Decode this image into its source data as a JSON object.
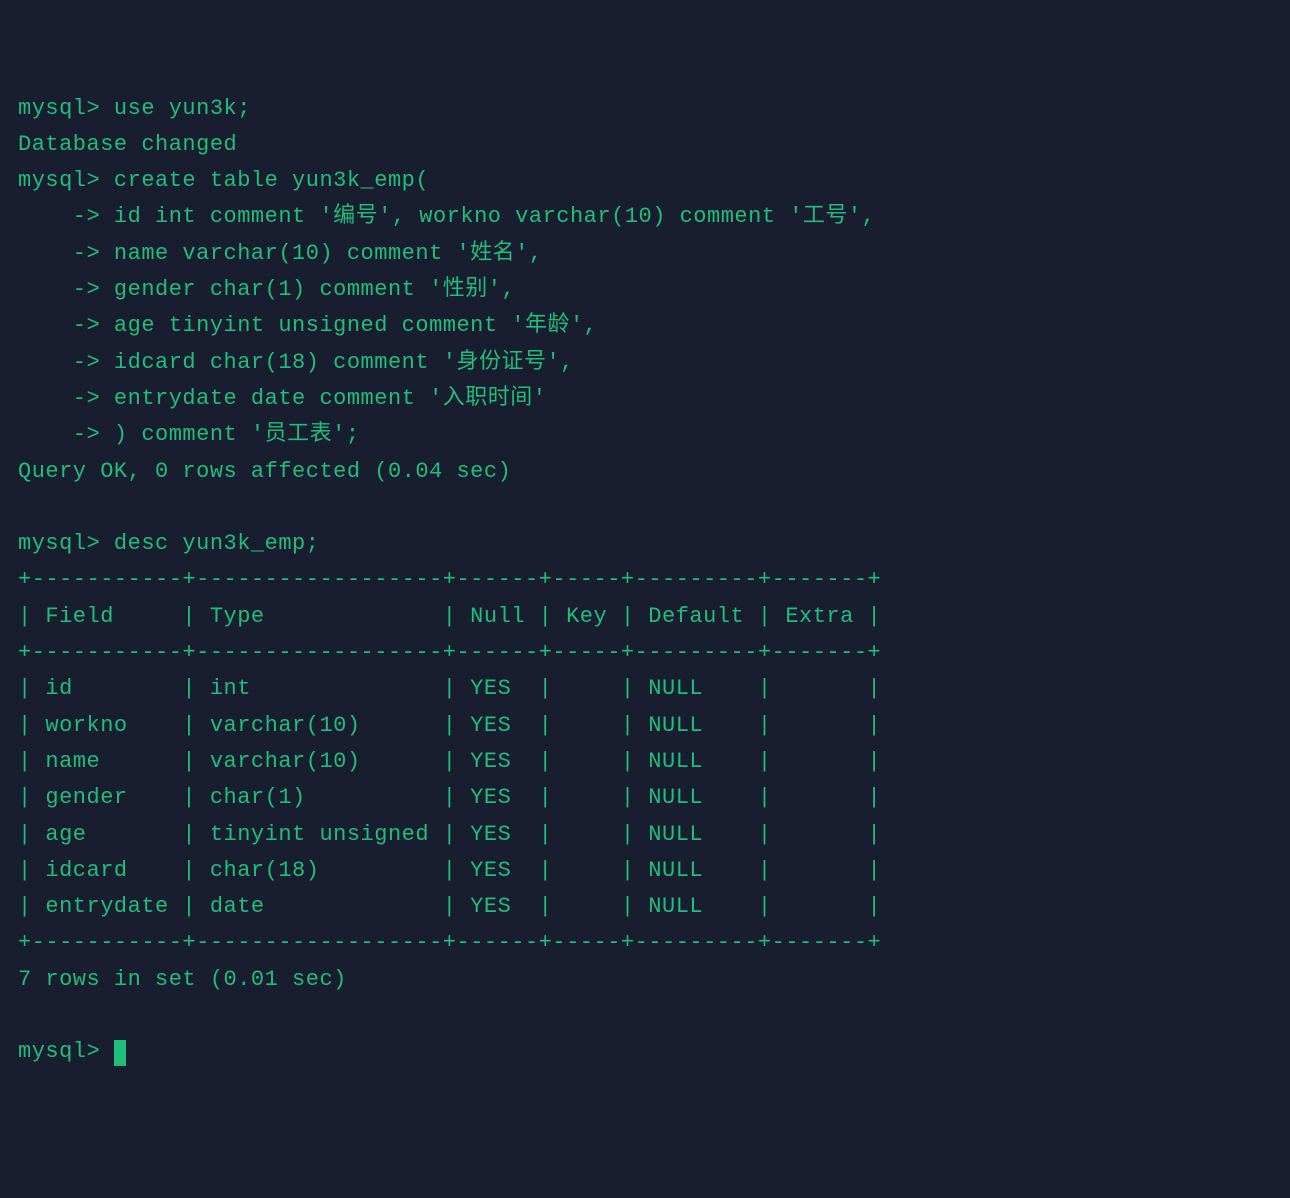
{
  "lines": {
    "l1": "mysql> use yun3k;",
    "l2": "Database changed",
    "l3": "mysql> create table yun3k_emp(",
    "l4": "    -> id int comment '编号', workno varchar(10) comment '工号',",
    "l5": "    -> name varchar(10) comment '姓名',",
    "l6": "    -> gender char(1) comment '性别',",
    "l7": "    -> age tinyint unsigned comment '年龄',",
    "l8": "    -> idcard char(18) comment '身份证号',",
    "l9": "    -> entrydate date comment '入职时间'",
    "l10": "    -> ) comment '员工表';",
    "l11": "Query OK, 0 rows affected (0.04 sec)",
    "l12": "",
    "l13": "mysql> desc yun3k_emp;",
    "l14": "+-----------+------------------+------+-----+---------+-------+",
    "l15": "| Field     | Type             | Null | Key | Default | Extra |",
    "l16": "+-----------+------------------+------+-----+---------+-------+",
    "l17": "| id        | int              | YES  |     | NULL    |       |",
    "l18": "| workno    | varchar(10)      | YES  |     | NULL    |       |",
    "l19": "| name      | varchar(10)      | YES  |     | NULL    |       |",
    "l20": "| gender    | char(1)          | YES  |     | NULL    |       |",
    "l21": "| age       | tinyint unsigned | YES  |     | NULL    |       |",
    "l22": "| idcard    | char(18)         | YES  |     | NULL    |       |",
    "l23": "| entrydate | date             | YES  |     | NULL    |       |",
    "l24": "+-----------+------------------+------+-----+---------+-------+",
    "l25": "7 rows in set (0.01 sec)",
    "l26": "",
    "l27": "mysql> "
  },
  "table": {
    "headers": [
      "Field",
      "Type",
      "Null",
      "Key",
      "Default",
      "Extra"
    ],
    "rows": [
      {
        "field": "id",
        "type": "int",
        "null": "YES",
        "key": "",
        "default": "NULL",
        "extra": ""
      },
      {
        "field": "workno",
        "type": "varchar(10)",
        "null": "YES",
        "key": "",
        "default": "NULL",
        "extra": ""
      },
      {
        "field": "name",
        "type": "varchar(10)",
        "null": "YES",
        "key": "",
        "default": "NULL",
        "extra": ""
      },
      {
        "field": "gender",
        "type": "char(1)",
        "null": "YES",
        "key": "",
        "default": "NULL",
        "extra": ""
      },
      {
        "field": "age",
        "type": "tinyint unsigned",
        "null": "YES",
        "key": "",
        "default": "NULL",
        "extra": ""
      },
      {
        "field": "idcard",
        "type": "char(18)",
        "null": "YES",
        "key": "",
        "default": "NULL",
        "extra": ""
      },
      {
        "field": "entrydate",
        "type": "date",
        "null": "YES",
        "key": "",
        "default": "NULL",
        "extra": ""
      }
    ],
    "summary": "7 rows in set (0.01 sec)"
  },
  "commands": {
    "use_db": "use yun3k;",
    "create_table": "create table yun3k_emp(",
    "desc_table": "desc yun3k_emp;"
  }
}
